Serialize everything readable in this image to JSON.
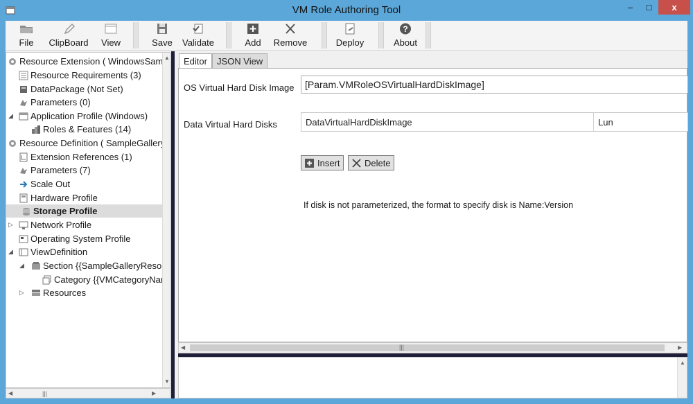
{
  "window": {
    "title": "VM Role Authoring Tool",
    "minimize": "–",
    "maximize": "□",
    "close": "x"
  },
  "toolbar": {
    "file": "File",
    "clipboard": "ClipBoard",
    "view": "View",
    "save": "Save",
    "validate": "Validate",
    "add": "Add",
    "remove": "Remove",
    "deploy": "Deploy",
    "about": "About"
  },
  "tree": {
    "resource_extension": "Resource Extension ( WindowsSamp",
    "resource_requirements": "Resource Requirements (3)",
    "data_package": "DataPackage (Not Set)",
    "parameters_ext": "Parameters (0)",
    "application_profile": "Application Profile (Windows)",
    "roles_features": "Roles & Features (14)",
    "resource_definition": "Resource Definition ( SampleGallery",
    "extension_references": "Extension References (1)",
    "parameters_def": "Parameters (7)",
    "scale_out": "Scale Out",
    "hardware_profile": "Hardware Profile",
    "storage_profile": "Storage Profile",
    "network_profile": "Network Profile",
    "os_profile": "Operating System Profile",
    "view_definition": "ViewDefinition",
    "section": "Section {{SampleGalleryResou",
    "category": "Category {{VMCategoryNar",
    "resources": "Resources"
  },
  "tabs": {
    "editor": "Editor",
    "json_view": "JSON View"
  },
  "form": {
    "os_vhd_label": "OS Virtual Hard Disk Image",
    "os_vhd_value": "[Param.VMRoleOSVirtualHardDiskImage]",
    "data_vhd_label": "Data Virtual Hard Disks",
    "col_image": "DataVirtualHardDiskImage",
    "col_lun": "Lun",
    "insert": "Insert",
    "delete": "Delete",
    "hint": "If disk is not parameterized, the format to specify disk is Name:Version"
  },
  "colors": {
    "window_frame": "#5ba7d9",
    "close_button": "#c7504b",
    "splitter": "#1f1f3a",
    "selected_row": "#dcdcdc"
  }
}
